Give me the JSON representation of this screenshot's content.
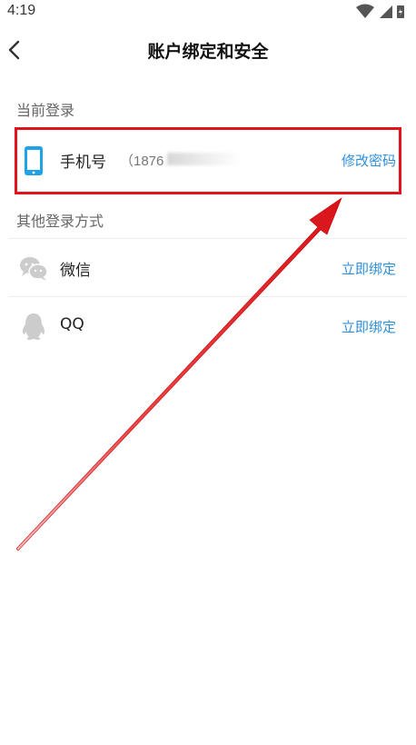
{
  "status": {
    "time": "4:19"
  },
  "header": {
    "title": "账户绑定和安全"
  },
  "current_login": {
    "label": "当前登录",
    "item": {
      "title": "手机号",
      "phone_prefix": "（1876",
      "action": "修改密码"
    }
  },
  "other_login": {
    "label": "其他登录方式",
    "items": [
      {
        "title": "微信",
        "action": "立即绑定"
      },
      {
        "title": "QQ",
        "action": "立即绑定"
      }
    ]
  },
  "colors": {
    "accent": "#2e8fdb",
    "highlight": "#e0141c",
    "phone_icon": "#1fa3e8",
    "gray_icon": "#cccccc"
  }
}
